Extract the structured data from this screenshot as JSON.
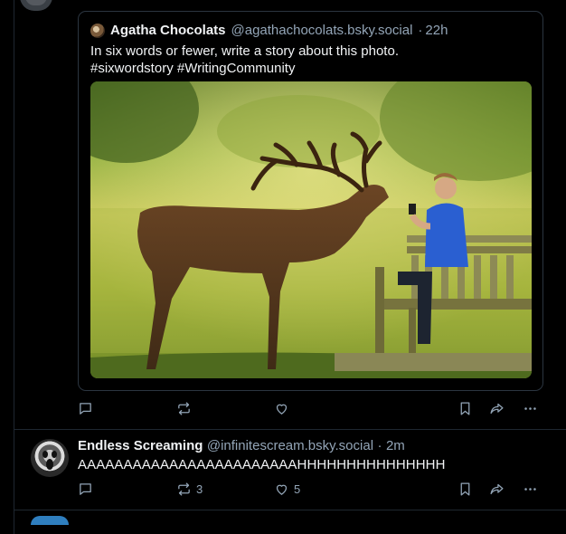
{
  "quoted_post": {
    "author_name": "Agatha Chocolats",
    "handle": "@agathachocolats.bsky.social",
    "separator": "·",
    "time": "22h",
    "text_line1": "In six words or fewer, write a story about this photo.",
    "text_line2": "#sixwordstory #WritingCommunity",
    "image_icon": "deer-and-person-on-bench-photo"
  },
  "post1_actions": {
    "reply_icon": "reply-icon",
    "repost_icon": "repost-icon",
    "like_icon": "heart-icon",
    "bookmark_icon": "bookmark-icon",
    "share_icon": "share-icon",
    "more_icon": "more-icon"
  },
  "post2": {
    "author_name": "Endless Screaming",
    "handle": "@infinitescream.bsky.social",
    "separator": "·",
    "time": "2m",
    "text": "AAAAAAAAAAAAAAAAAAAAAAAAHHHHHHHHHHHHHHH",
    "repost_count": "3",
    "like_count": "5"
  },
  "colors": {
    "background": "#000000",
    "text": "#f1f3f5",
    "muted": "#93a5b7",
    "border": "#2b3540"
  }
}
